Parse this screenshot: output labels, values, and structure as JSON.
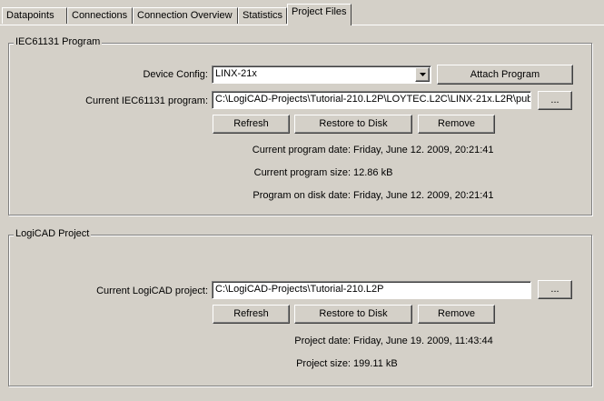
{
  "tabs": [
    {
      "label": "Datapoints"
    },
    {
      "label": "Connections"
    },
    {
      "label": "Connection Overview"
    },
    {
      "label": "Statistics"
    },
    {
      "label": "Project Files"
    }
  ],
  "iec_group": {
    "title": "IEC61131 Program",
    "device_config_label": "Device Config:",
    "device_config_value": "LINX-21x",
    "attach_button": "Attach Program",
    "current_program_label": "Current IEC61131 program:",
    "current_program_value": "C:\\LogiCAD-Projects\\Tutorial-210.L2P\\LOYTEC.L2C\\LINX-21x.L2R\\pub",
    "browse_button": "...",
    "refresh_button": "Refresh",
    "restore_button": "Restore to Disk",
    "remove_button": "Remove",
    "program_date_label": "Current program date:",
    "program_date_value": "Friday, June 12. 2009, 20:21:41",
    "program_size_label": "Current program size:",
    "program_size_value": "12.86 kB",
    "disk_date_label": "Program on disk date:",
    "disk_date_value": "Friday, June 12. 2009, 20:21:41"
  },
  "logicad_group": {
    "title": "LogiCAD Project",
    "current_project_label": "Current LogiCAD project:",
    "current_project_value": "C:\\LogiCAD-Projects\\Tutorial-210.L2P",
    "browse_button": "...",
    "refresh_button": "Refresh",
    "restore_button": "Restore to Disk",
    "remove_button": "Remove",
    "project_date_label": "Project date:",
    "project_date_value": "Friday, June 19. 2009, 11:43:44",
    "project_size_label": "Project size:",
    "project_size_value": "199.11 kB"
  },
  "icons": {
    "dropdown": "chevron-down-icon"
  }
}
